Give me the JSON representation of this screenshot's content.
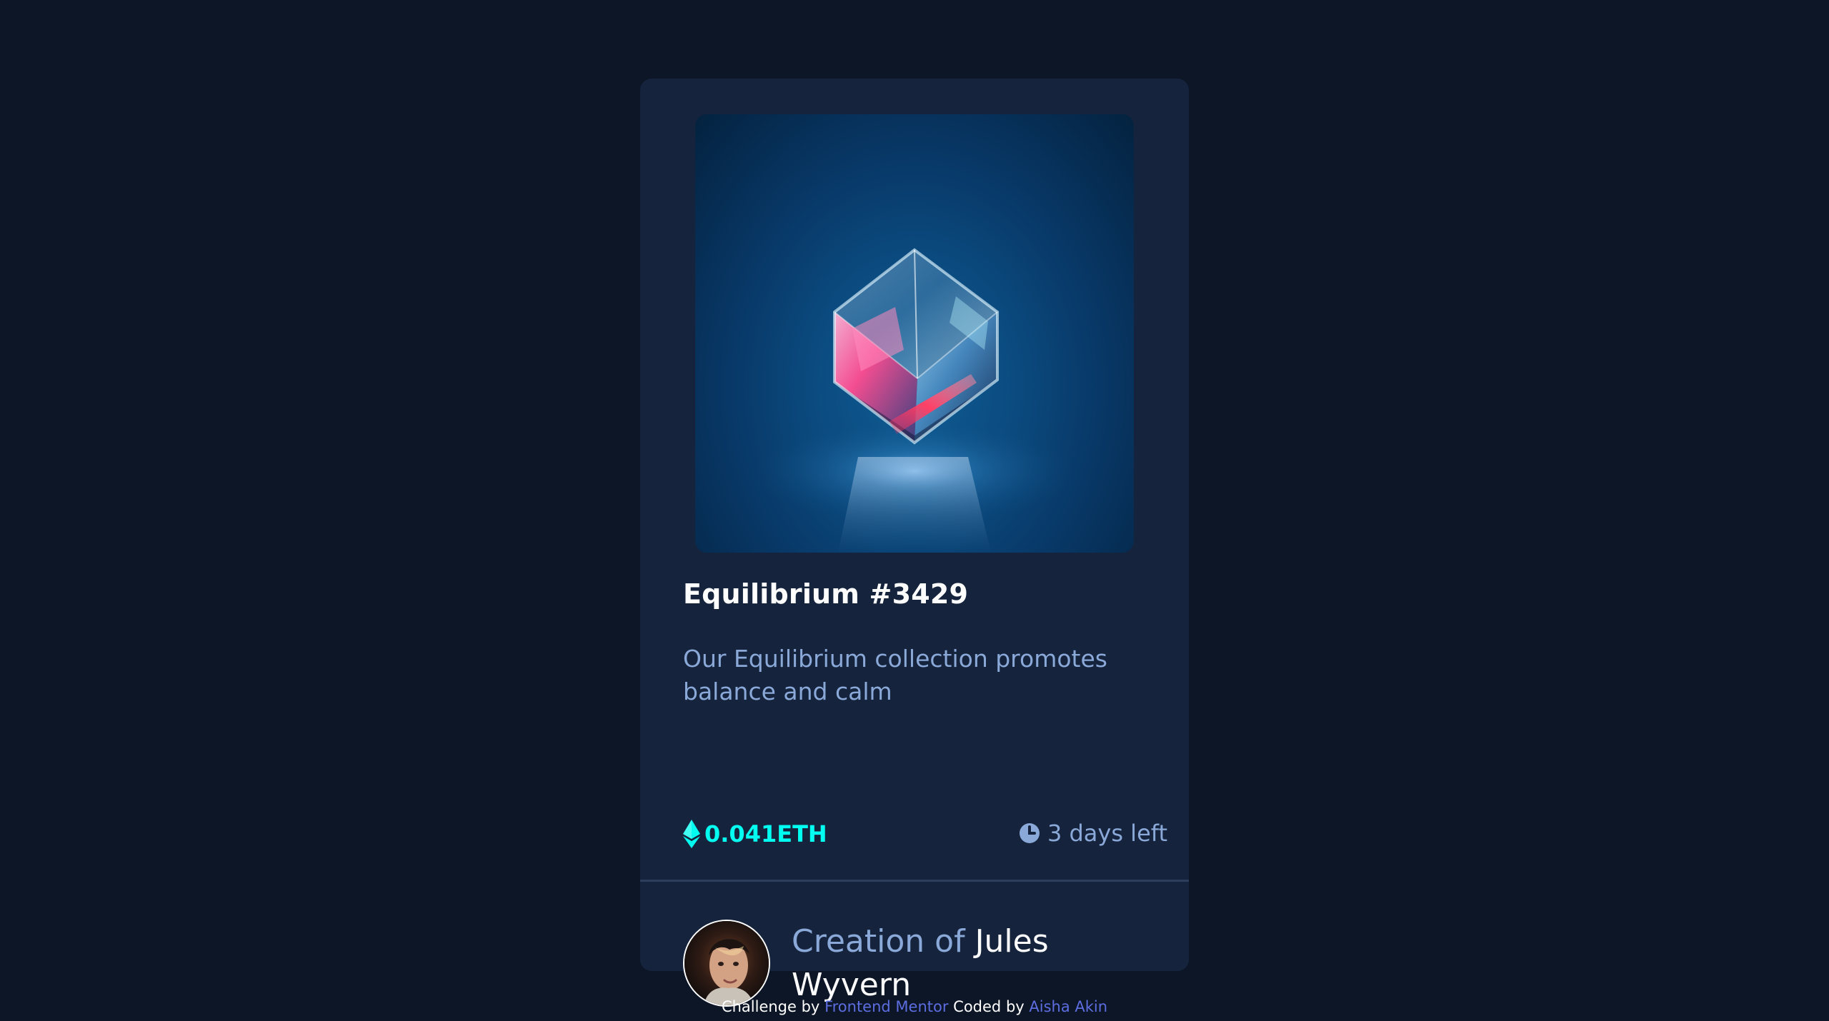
{
  "card": {
    "title": "Equilibrium #3429",
    "description": "Our Equilibrium collection promotes balance and calm",
    "price": "0.041ETH",
    "time_left": "3 days left"
  },
  "creator": {
    "prefix": "Creation of",
    "name": "Jules Wyvern"
  },
  "attribution": {
    "challenge_text": "Challenge by",
    "challenge_link": "Frontend Mentor",
    "coded_text": "Coded by",
    "coded_link": "Aisha Akin"
  },
  "icons": {
    "price": "ethereum-icon",
    "time": "clock-icon"
  },
  "colors": {
    "background": "#0d1627",
    "card": "#15233d",
    "accent_cyan": "#00fff0",
    "soft_blue": "#8aa9d8",
    "link": "#5c6de0"
  }
}
